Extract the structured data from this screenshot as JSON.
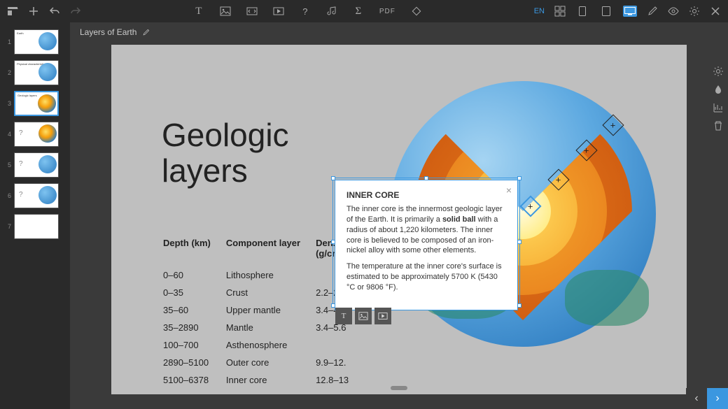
{
  "lang": "EN",
  "pdf_label": "PDF",
  "doc_title": "Layers of Earth",
  "thumbs": [
    {
      "num": "1",
      "label": "Earth"
    },
    {
      "num": "2",
      "label": "Physical characteristics"
    },
    {
      "num": "3",
      "label": "Geologic layers"
    },
    {
      "num": "4",
      "label": "?"
    },
    {
      "num": "5",
      "label": "?"
    },
    {
      "num": "6",
      "label": "?"
    },
    {
      "num": "7",
      "label": ""
    }
  ],
  "slide": {
    "title_l1": "Geologic",
    "title_l2": "layers",
    "headers": {
      "depth": "Depth (km)",
      "component": "Component layer",
      "density": "Density (g/cm³)"
    },
    "rows": [
      {
        "depth": "0–60",
        "component": "Lithosphere",
        "density": ""
      },
      {
        "depth": "0–35",
        "component": "Crust",
        "density": "2.2–2.9"
      },
      {
        "depth": "35–60",
        "component": "Upper mantle",
        "density": "3.4–4.4"
      },
      {
        "depth": "35–2890",
        "component": "Mantle",
        "density": "3.4–5.6"
      },
      {
        "depth": "100–700",
        "component": "Asthenosphere",
        "density": ""
      },
      {
        "depth": "2890–5100",
        "component": "Outer core",
        "density": "9.9–12."
      },
      {
        "depth": "5100–6378",
        "component": "Inner core",
        "density": "12.8–13"
      }
    ]
  },
  "popup": {
    "title": "INNER CORE",
    "p1a": "The inner core is the innermost geologic layer of the Earth. It is primarily a ",
    "p1_bold": "solid ball",
    "p1b": " with a radius of about 1,220 kilometers. The inner core is believed to be composed of an iron-nickel alloy with some other elements.",
    "p2": "The temperature at the inner core's surface is estimated to be approximately 5700 K (5430 °C or 9806 °F).",
    "close": "×"
  },
  "popup_tools": {
    "text": "T"
  },
  "nav": {
    "prev": "‹",
    "next": "›"
  }
}
